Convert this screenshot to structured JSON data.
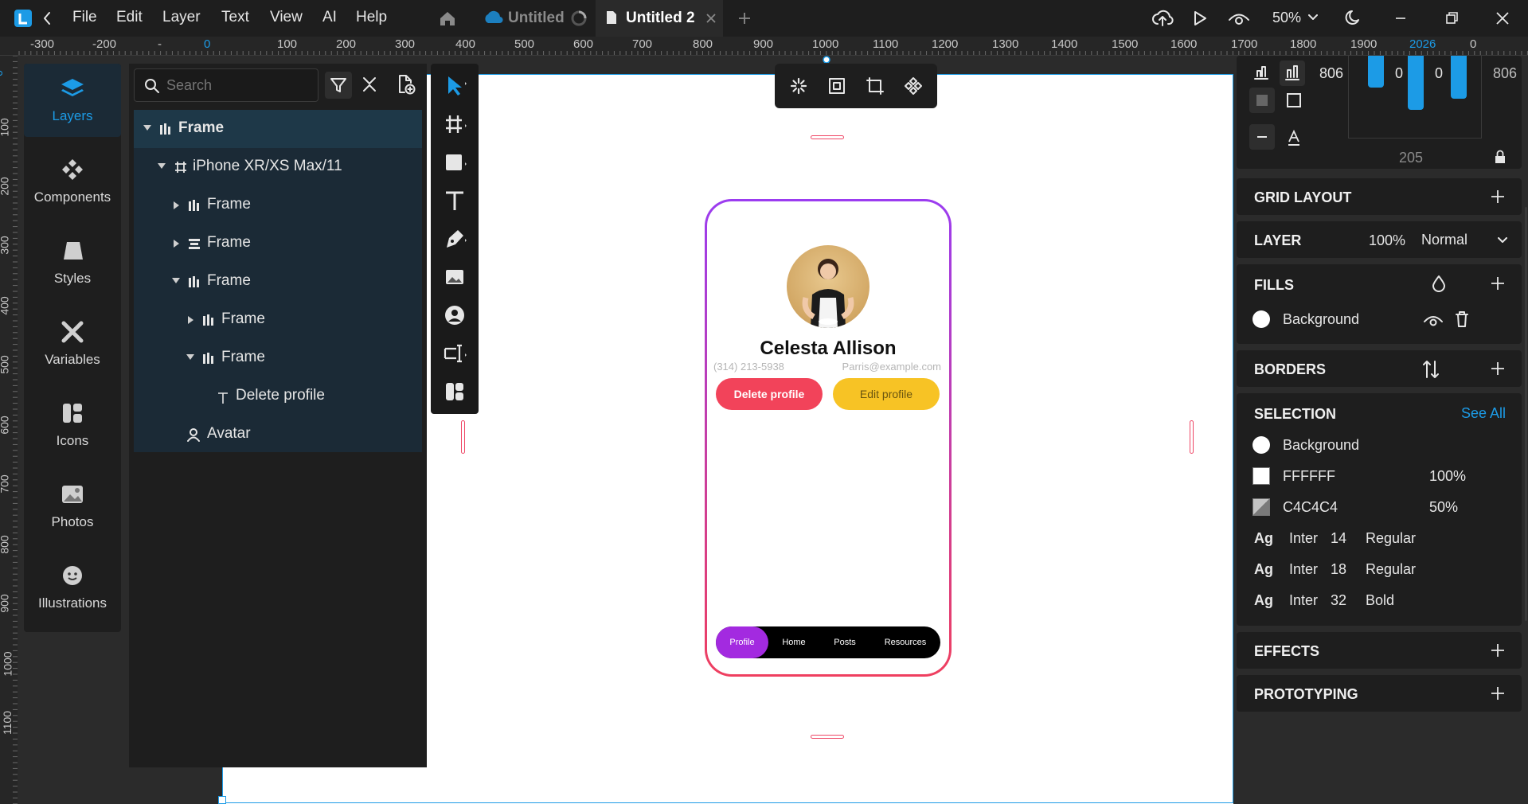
{
  "menu": {
    "file": "File",
    "edit": "Edit",
    "layer": "Layer",
    "text": "Text",
    "view": "View",
    "ai": "AI",
    "help": "Help"
  },
  "tabs": [
    {
      "label": "Untitled"
    },
    {
      "label": "Untitled 2"
    }
  ],
  "zoom": "50%",
  "hruler": [
    "-300",
    "-200",
    "-",
    "0",
    "100",
    "200",
    "300",
    "400",
    "500",
    "600",
    "700",
    "800",
    "900",
    "1000",
    "1100",
    "1200",
    "1300",
    "1400",
    "1500",
    "1600",
    "1700",
    "1800",
    "1900",
    "2026",
    "0"
  ],
  "vruler": [
    "0",
    "100",
    "200",
    "300",
    "400",
    "500",
    "600",
    "700",
    "800",
    "900",
    "1000",
    "1100"
  ],
  "rail": [
    {
      "label": "Layers",
      "icon": "layers-icon"
    },
    {
      "label": "Components",
      "icon": "components-icon"
    },
    {
      "label": "Styles",
      "icon": "styles-icon"
    },
    {
      "label": "Variables",
      "icon": "variables-icon"
    },
    {
      "label": "Icons",
      "icon": "icons-icon"
    },
    {
      "label": "Photos",
      "icon": "photos-icon"
    },
    {
      "label": "Illustrations",
      "icon": "illustrations-icon"
    }
  ],
  "search": {
    "placeholder": "Search"
  },
  "layers": [
    {
      "label": "Frame"
    },
    {
      "label": "iPhone XR/XS Max/11"
    },
    {
      "label": "Frame"
    },
    {
      "label": "Frame"
    },
    {
      "label": "Frame"
    },
    {
      "label": "Frame"
    },
    {
      "label": "Frame"
    },
    {
      "label": "Delete profile"
    },
    {
      "label": "Avatar"
    }
  ],
  "profile": {
    "name": "Celesta Allison",
    "phone": "(314) 213-5938",
    "email": "Parris@example.com",
    "delete_label": "Delete profile",
    "edit_label": "Edit profile",
    "nav": [
      "Profile",
      "Home",
      "Posts",
      "Resources"
    ]
  },
  "inspector": {
    "width_left": "806",
    "width_right": "806",
    "pad_a": "0",
    "pad_b": "0",
    "gap": "205",
    "grid_layout": "GRID LAYOUT",
    "layer": {
      "title": "LAYER",
      "opacity": "100%",
      "blend": "Normal"
    },
    "fills": {
      "title": "FILLS",
      "item": "Background"
    },
    "borders": {
      "title": "BORDERS"
    },
    "selection": {
      "title": "SELECTION",
      "see_all": "See All",
      "background": "Background",
      "colors": [
        {
          "hex": "FFFFFF",
          "opacity": "100%"
        },
        {
          "hex": "C4C4C4",
          "opacity": "50%"
        }
      ],
      "fonts": [
        {
          "ag": "Ag",
          "family": "Inter",
          "size": "14",
          "weight": "Regular"
        },
        {
          "ag": "Ag",
          "family": "Inter",
          "size": "18",
          "weight": "Regular"
        },
        {
          "ag": "Ag",
          "family": "Inter",
          "size": "32",
          "weight": "Bold"
        }
      ]
    },
    "effects": {
      "title": "EFFECTS"
    },
    "prototyping": {
      "title": "PROTOTYPING"
    }
  },
  "colors": {
    "accent": "#1c9be6",
    "delete": "#f2435a",
    "edit": "#f7c325",
    "nav_active": "#a32ae0",
    "phone_border_top": "#9b3cf0",
    "phone_border_bottom": "#ef3f5f",
    "handle": "#ef4766"
  }
}
